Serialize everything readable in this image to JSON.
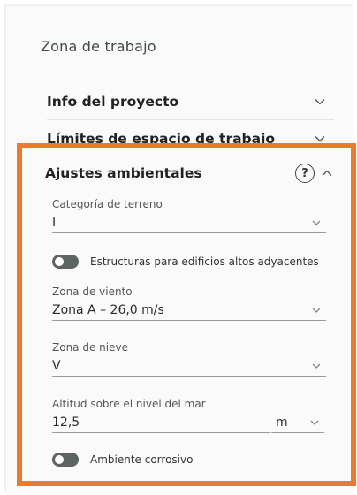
{
  "panel": {
    "title": "Zona de trabajo"
  },
  "accordions": [
    {
      "label": "Info del proyecto"
    },
    {
      "label": "Límites de espacio de trabajo"
    }
  ],
  "section": {
    "title": "Ajustes ambientales",
    "help_icon": "question-circle-icon",
    "terrain": {
      "label": "Categoría de terreno",
      "value": "I"
    },
    "tall_buildings_toggle": {
      "label": "Estructuras para edificios altos adyacentes",
      "on": false
    },
    "wind": {
      "label": "Zona de viento",
      "value": "Zona A – 26,0 m/s"
    },
    "snow": {
      "label": "Zona de nieve",
      "value": "V"
    },
    "altitude": {
      "label": "Altitud sobre el nivel del mar",
      "value": "12,5",
      "unit": "m"
    },
    "corrosive_toggle": {
      "label": "Ambiente corrosivo",
      "on": false
    }
  },
  "colors": {
    "highlight": "#ec7a2e",
    "toggle_off": "#5e6461"
  }
}
